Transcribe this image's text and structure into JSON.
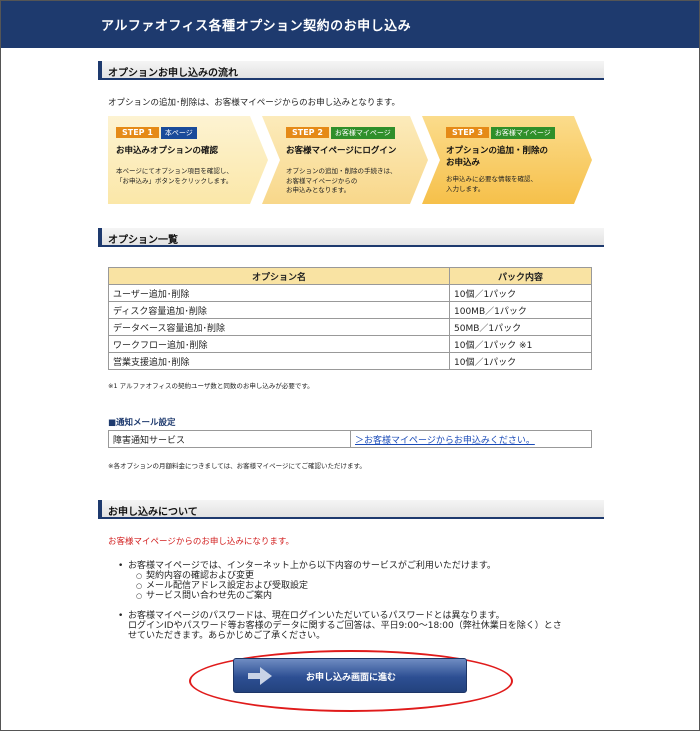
{
  "header": {
    "title": "アルファオフィス各種オプション契約のお申し込み"
  },
  "flow": {
    "heading": "オプションお申し込みの流れ",
    "intro": "オプションの追加･削除は、お客様マイページからのお申し込みとなります。",
    "steps": [
      {
        "badge": "STEP 1",
        "tag": "本ページ",
        "title": "お申込みオプションの確認",
        "desc1": "本ページにてオプション項目を確認し、",
        "desc2": "「お申込み」ボタンをクリックします。",
        "desc3": ""
      },
      {
        "badge": "STEP 2",
        "tag": "お客様マイページ",
        "title": "お客様マイページにログイン",
        "desc1": "オプションの追加・削除の手続きは、",
        "desc2": "お客様マイページからの",
        "desc3": "お申込みとなります。"
      },
      {
        "badge": "STEP 3",
        "tag": "お客様マイページ",
        "title": "オプションの追加・削除の",
        "title2": "お申込み",
        "desc1": "お申込みに必要な情報を確認、",
        "desc2": "入力します。",
        "desc3": ""
      }
    ]
  },
  "options": {
    "heading": "オプション一覧",
    "columns": [
      "オプション名",
      "パック内容"
    ],
    "rows": [
      [
        "ユーザー追加･削除",
        "10個／1パック"
      ],
      [
        "ディスク容量追加･削除",
        "100MB／1パック"
      ],
      [
        "データベース容量追加･削除",
        "50MB／1パック"
      ],
      [
        "ワークフロー追加･削除",
        "10個／1パック ※1"
      ],
      [
        "営業支援追加･削除",
        "10個／1パック"
      ]
    ],
    "note": "※1 アルファオフィスの契約ユーザ数と同数のお申し込みが必要です。"
  },
  "mail": {
    "heading": "■通知メール設定",
    "label": "障害通知サービス",
    "link": "＞お客様マイページからお申込みください。",
    "note": "※各オプションの月額料金につきましては、お客様マイページにてご確認いただけます。"
  },
  "apply": {
    "heading": "お申し込みについて",
    "red_note": "お客様マイページからのお申し込みになります。",
    "bullet1": "お客様マイページでは、インターネット上から以下内容のサービスがご利用いただけます。",
    "sub": [
      "契約内容の確認および変更",
      "メール配信アドレス設定および受取設定",
      "サービス問い合わせ先のご案内"
    ],
    "bullet2_line1": "お客様マイページのパスワードは、現在ログインいただいているパスワードとは異なります。",
    "bullet2_line2": "ログインIDやパスワード等お客様のデータに関するご回答は、平日9:00～18:00（弊社休業日を除く）とさ",
    "bullet2_line3": "せていただきます。あらかじめご了承ください。",
    "button_label": "お申し込み画面に進む"
  },
  "colors": {
    "header": "#1e3a6e",
    "step_badge": "#e58a17",
    "table_head": "#f9e3a3",
    "highlight_oval": "#e01b1b"
  }
}
